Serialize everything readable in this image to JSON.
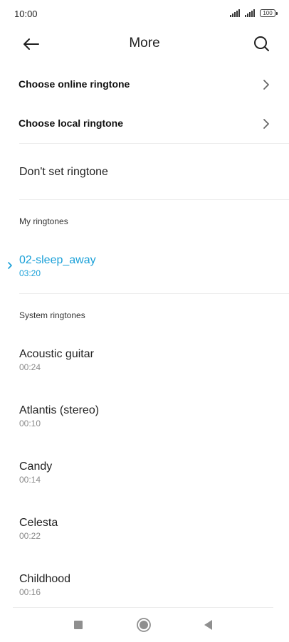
{
  "status": {
    "time": "10:00",
    "battery": "100"
  },
  "header": {
    "title": "More",
    "back_icon": "arrow-left-icon",
    "search_icon": "search-icon"
  },
  "online_ringtone": {
    "label": "Choose online ringtone"
  },
  "local_ringtone": {
    "label": "Choose local ringtone"
  },
  "dont_set": {
    "label": "Don't set ringtone"
  },
  "my_ringtones": {
    "heading": "My ringtones",
    "items": [
      {
        "name": "02-sleep_away",
        "duration": "03:20",
        "selected": true
      }
    ]
  },
  "system_ringtones": {
    "heading": "System ringtones",
    "items": [
      {
        "name": "Acoustic guitar",
        "duration": "00:24"
      },
      {
        "name": "Atlantis (stereo)",
        "duration": "00:10"
      },
      {
        "name": "Candy",
        "duration": "00:14"
      },
      {
        "name": "Celesta",
        "duration": "00:22"
      },
      {
        "name": "Childhood",
        "duration": "00:16"
      }
    ]
  },
  "colors": {
    "accent": "#1aa0d8",
    "text": "#222222",
    "secondary_text": "#8a8a8a"
  },
  "navbar": {
    "recents_icon": "square-icon",
    "home_icon": "circle-home-icon",
    "back_icon": "triangle-back-icon"
  }
}
